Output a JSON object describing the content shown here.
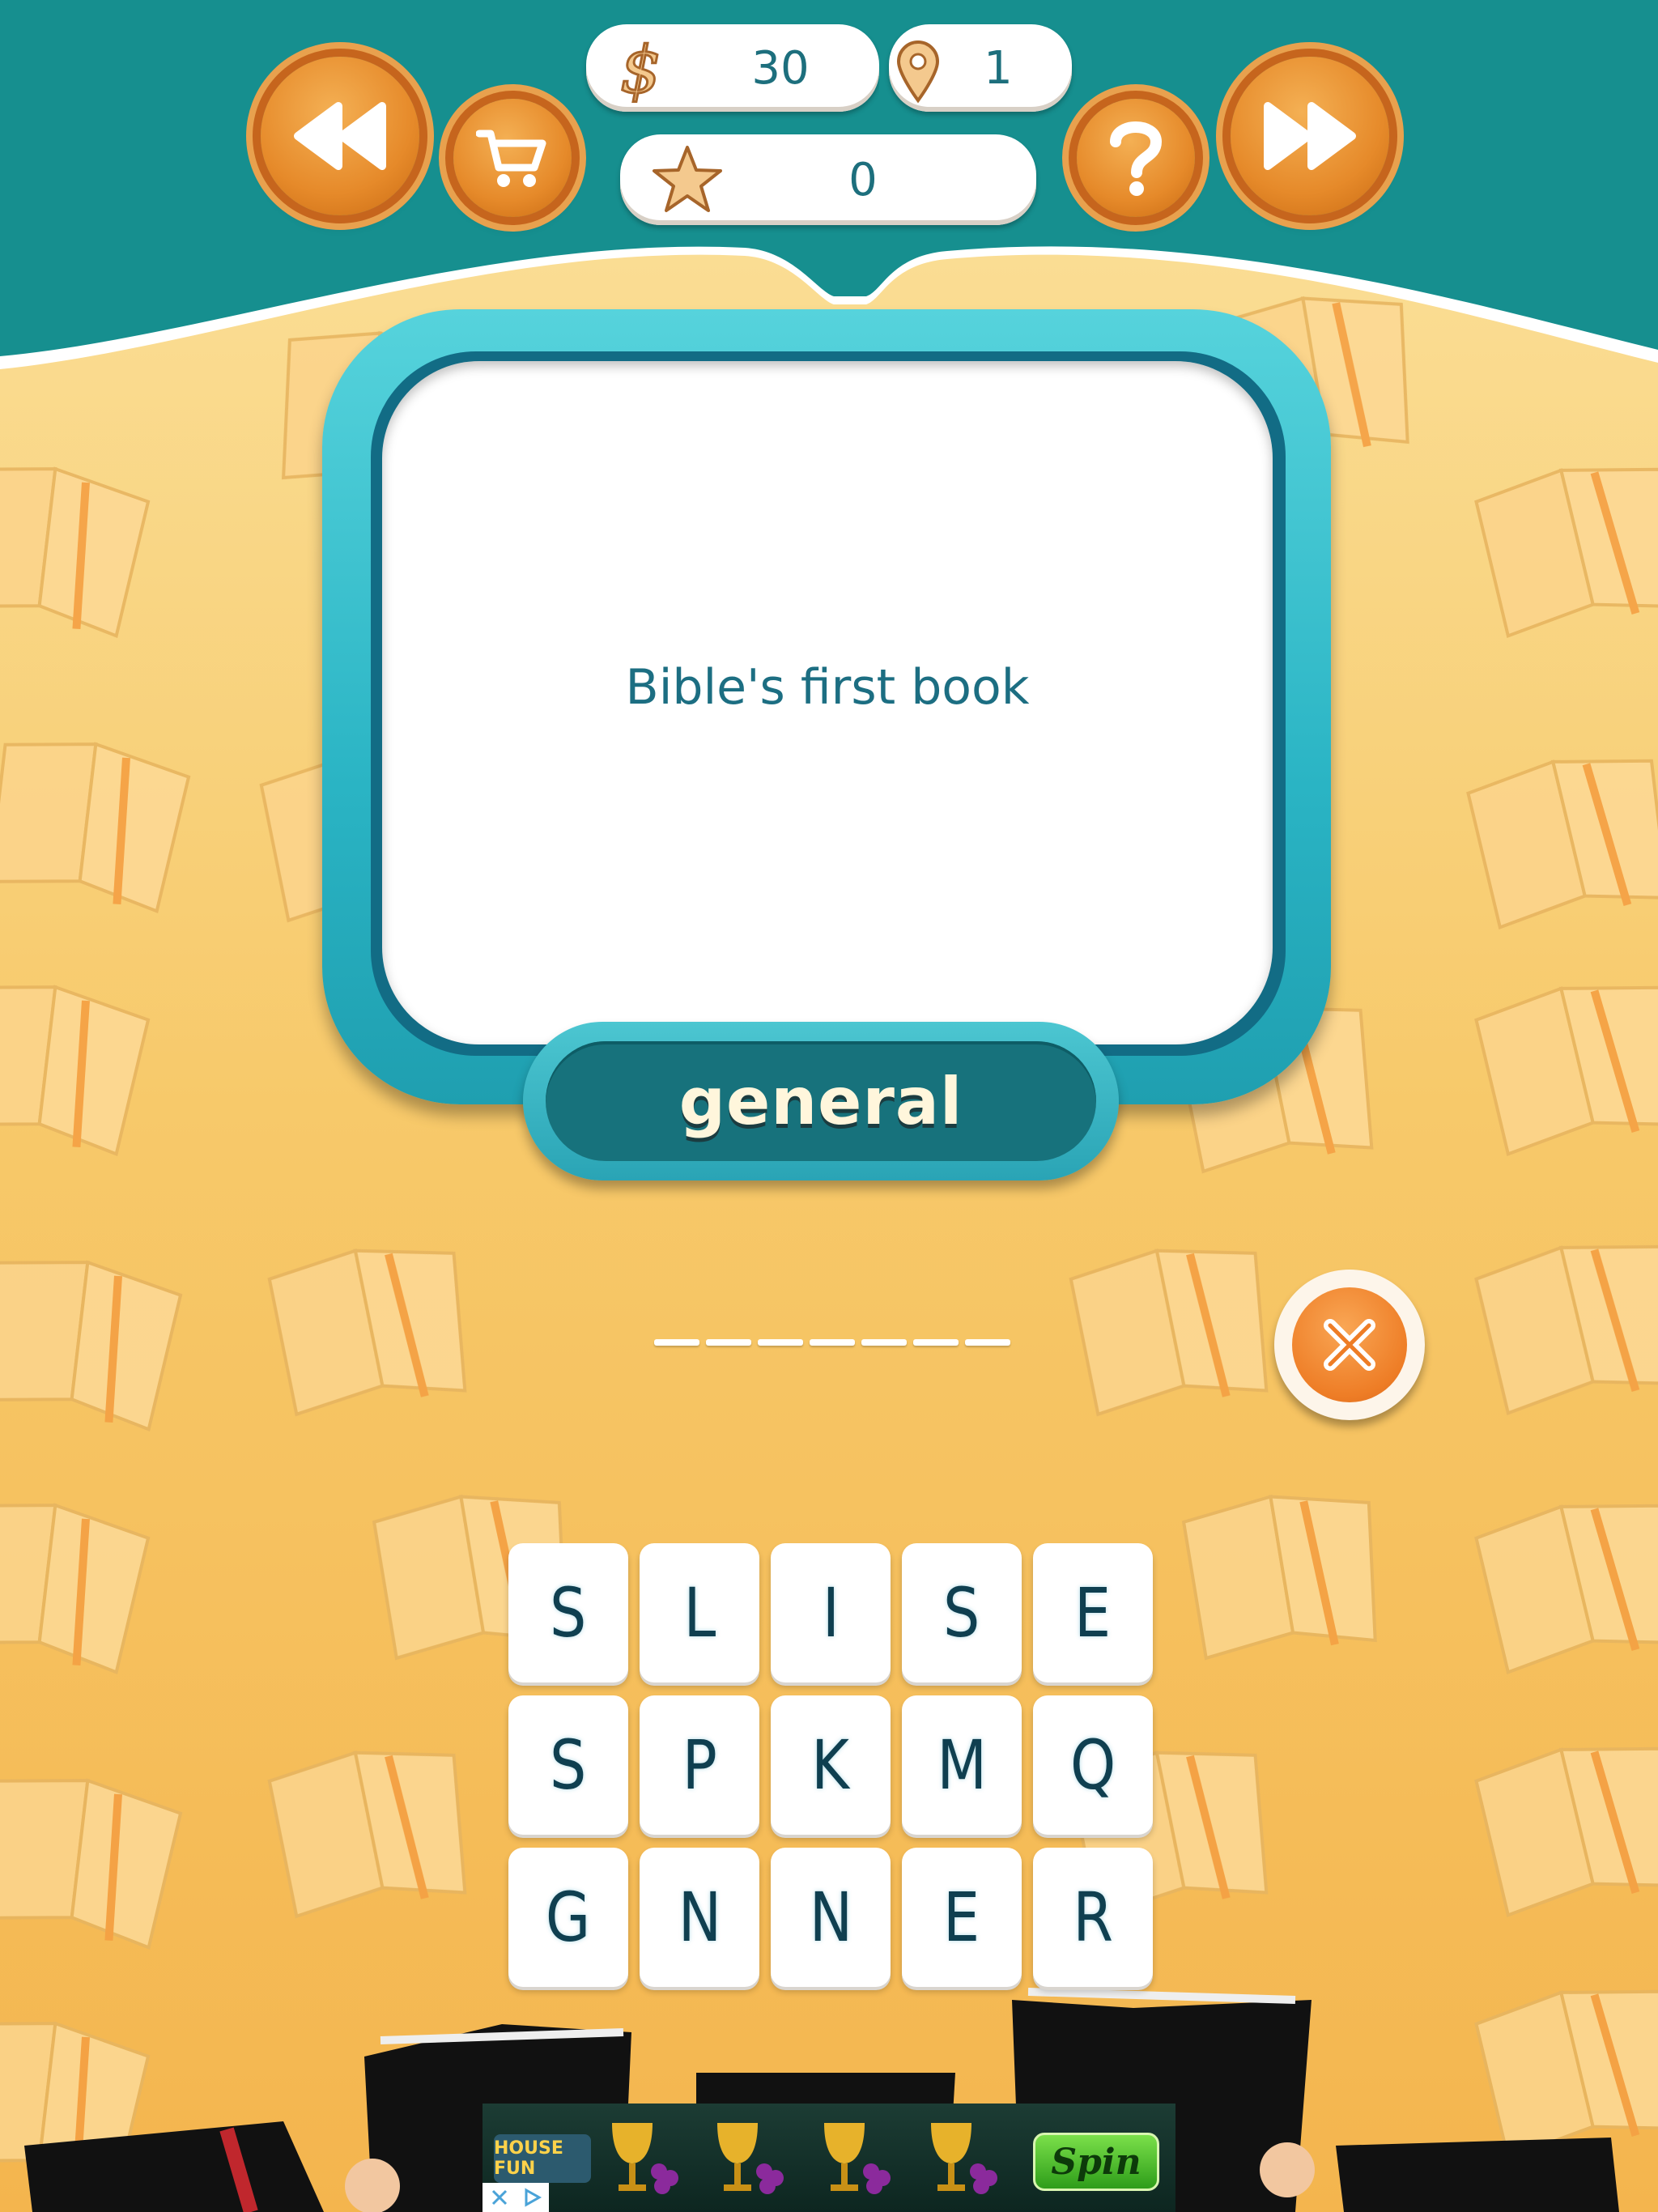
{
  "hud": {
    "coins_value": "30",
    "level_value": "1",
    "stars_value": "0"
  },
  "icons": {
    "rewind": "rewind-icon",
    "cart": "cart-icon",
    "help": "question-icon",
    "forward": "fast-forward-icon",
    "coins": "dollar-icon",
    "level": "map-pin-icon",
    "stars": "star-icon",
    "clear": "close-icon"
  },
  "clue": {
    "text": "Bible's first book",
    "category": "general"
  },
  "answer": {
    "length": 7
  },
  "letters": [
    [
      "S",
      "L",
      "I",
      "S",
      "E"
    ],
    [
      "S",
      "P",
      "K",
      "M",
      "Q"
    ],
    [
      "G",
      "N",
      "N",
      "E",
      "R"
    ]
  ],
  "ad": {
    "logo_text": "HOUSE FUN",
    "spin_label": "Spin"
  },
  "colors": {
    "header_teal": "#168f8f",
    "accent_orange": "#e68a2a",
    "card_frame": "#2ab4c4",
    "category_bg": "#17727c",
    "text_teal": "#1c6e82"
  }
}
